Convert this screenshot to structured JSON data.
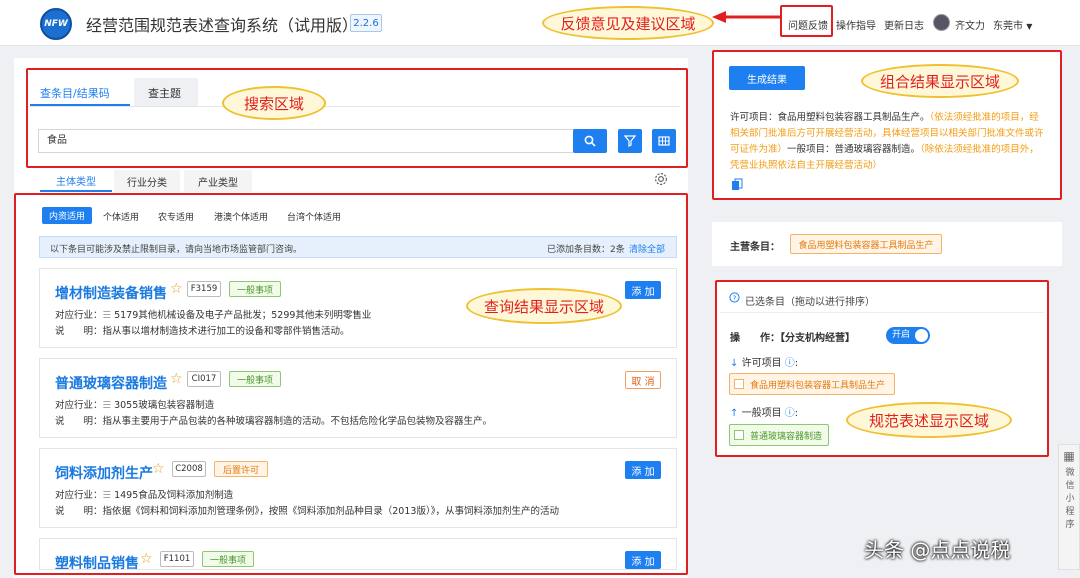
{
  "header": {
    "logo_text": "NFW",
    "title": "经营范围规范表述查询系统（试用版）",
    "version": "2.2.6",
    "links": [
      "问题反馈",
      "操作指导",
      "更新日志"
    ],
    "user": "齐文力",
    "city": "东莞市"
  },
  "callouts": {
    "feedback": "反馈意见及建议区域",
    "search": "搜索区域",
    "results": "查询结果显示区域",
    "combined": "组合结果显示区域",
    "normative": "规范表述显示区域"
  },
  "search": {
    "tabs": [
      "查条目/结果码",
      "查主题"
    ],
    "value": "食品"
  },
  "subtabs": [
    "主体类型",
    "行业分类",
    "产业类型"
  ],
  "filters": [
    "内资适用",
    "个体适用",
    "农专适用",
    "港澳个体适用",
    "台湾个体适用"
  ],
  "notice": {
    "text": "以下条目可能涉及禁止限制目录，请向当地市场监管部门咨询。",
    "count_label": "已添加条目数：2条",
    "clear_label": "清除全部"
  },
  "results": [
    {
      "title": "增材制造装备销售",
      "code": "F3159",
      "tag": "一般事项",
      "tag_type": "green",
      "industry_label": "对应行业：",
      "industry": "5179其他机械设备及电子产品批发；5299其他未列明零售业",
      "desc_label": "说　　明：",
      "desc": "指从事以增材制造技术进行加工的设备和零部件销售活动。",
      "action": "添 加"
    },
    {
      "title": "普通玻璃容器制造",
      "code": "CI017",
      "tag": "一般事项",
      "tag_type": "green",
      "industry_label": "对应行业：",
      "industry": "3055玻璃包装容器制造",
      "desc_label": "说　　明：",
      "desc": "指从事主要用于产品包装的各种玻璃容器制造的活动。不包括危险化学品包装物及容器生产。",
      "action": "取 消"
    },
    {
      "title": "饲料添加剂生产",
      "code": "C2008",
      "tag": "后置许可",
      "tag_type": "orange",
      "industry_label": "对应行业：",
      "industry": "1495食品及饲料添加剂制造",
      "desc_label": "说　　明：",
      "desc": "指依据《饲料和饲料添加剂管理条例》，按照《饲料添加剂品种目录（2013版）》，从事饲料添加剂生产的活动",
      "action": "添 加"
    },
    {
      "title": "塑料制品销售",
      "code": "F1101",
      "tag": "一般事项",
      "tag_type": "green",
      "action": "添 加"
    }
  ],
  "combined": {
    "button": "生成结果",
    "line1": "许可项目：食品用塑料包装容器工具制品生产。",
    "line1_orange": "（依法须经批准的项目，经相关部门批准后方可开展经营活动，具体经营项目以相关部门批准文件或许可证件为准）",
    "line2": "一般项目：普通玻璃容器制造。",
    "line2_orange": "（除依法须经批准的项目外，凭营业执照依法自主开展经营活动）"
  },
  "main_item": {
    "label": "主营条目：",
    "value": "食品用塑料包装容器工具制品生产"
  },
  "selected": {
    "header": "已选条目（拖动以进行排序）",
    "op_label": "操　　作：【分支机构经营】",
    "toggle": "开启",
    "permit_label": "许可项目",
    "permit_item": "食品用塑料包装容器工具制品生产",
    "general_label": "一般项目",
    "general_item": "普通玻璃容器制造"
  },
  "side_widget": "微信小程序",
  "watermark": "头条 @点点说税",
  "colors": {
    "primary": "#1e7ff0",
    "red": "#e02020",
    "orange": "#f39c12",
    "green": "#4a9a2a"
  }
}
